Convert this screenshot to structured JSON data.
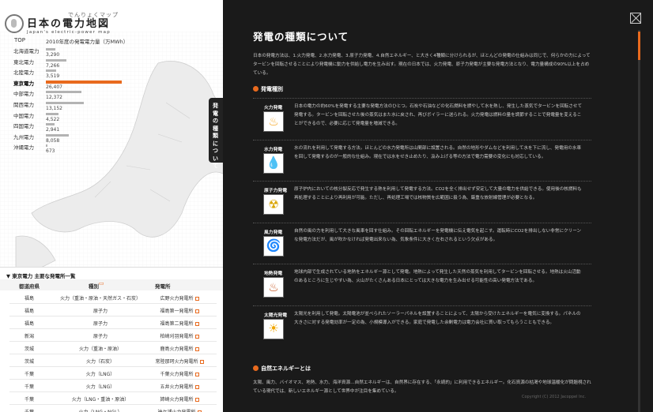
{
  "app": {
    "ruby": "でんりょくマップ",
    "title": "日本の電力地図",
    "subtitle": "Japan's electric-power map"
  },
  "map": {
    "top_label": "TOP",
    "year_label": "2010年度の発電電力量（万MWh）",
    "max_value": 26407,
    "regions": [
      {
        "name": "北海道電力",
        "value": 3290,
        "value_text": "3,290",
        "selected": false
      },
      {
        "name": "東北電力",
        "value": 7266,
        "value_text": "7,266",
        "selected": false
      },
      {
        "name": "北陸電力",
        "value": 3519,
        "value_text": "3,519",
        "selected": false
      },
      {
        "name": "東京電力",
        "value": 26407,
        "value_text": "26,407",
        "selected": true
      },
      {
        "name": "中部電力",
        "value": 12372,
        "value_text": "12,372",
        "selected": false
      },
      {
        "name": "関西電力",
        "value": 13152,
        "value_text": "13,152",
        "selected": false
      },
      {
        "name": "中国電力",
        "value": 4522,
        "value_text": "4,522",
        "selected": false
      },
      {
        "name": "四国電力",
        "value": 2941,
        "value_text": "2,941",
        "selected": false
      },
      {
        "name": "九州電力",
        "value": 8058,
        "value_text": "8,058",
        "selected": false
      },
      {
        "name": "沖縄電力",
        "value": 673,
        "value_text": "673",
        "selected": false
      }
    ]
  },
  "plant_list": {
    "title": "▼ 東京電力 主要な発電所一覧",
    "columns": [
      "都道府県",
      "種別",
      "発電所"
    ],
    "rows": [
      {
        "pref": "福島",
        "type": "火力（重油・原油・天然ガス・石炭）",
        "plant": "広野火力発電所"
      },
      {
        "pref": "福島",
        "type": "原子力",
        "plant": "福島第一発電所"
      },
      {
        "pref": "福島",
        "type": "原子力",
        "plant": "福島第二発電所"
      },
      {
        "pref": "新潟",
        "type": "原子力",
        "plant": "柏崎刈羽発電所"
      },
      {
        "pref": "茨城",
        "type": "火力（重油・原油）",
        "plant": "鹿島火力発電所"
      },
      {
        "pref": "茨城",
        "type": "火力（石炭）",
        "plant": "常陸那珂火力発電所"
      },
      {
        "pref": "千葉",
        "type": "火力（LNG）",
        "plant": "千葉火力発電所"
      },
      {
        "pref": "千葉",
        "type": "火力（LNG）",
        "plant": "五井火力発電所"
      },
      {
        "pref": "千葉",
        "type": "火力（LNG・重油・原油）",
        "plant": "姉崎火力発電所"
      },
      {
        "pref": "千葉",
        "type": "火力（LNG・NGL）",
        "plant": "袖ケ浦火力発電所"
      }
    ]
  },
  "side_tab": {
    "label": "発電の種類について"
  },
  "panel": {
    "title": "発電の種類について",
    "intro": "日本の発電方法は、1.火力発電、2.水力発電、3.原子力発電、4.自然エネルギー、と大きく4種類に分けられるが、ほとんどの発電の仕組みは同じで、何らかの力によってタービンを回転させることにより発電機に動力を供給し電力を生み出す。現在の日本では、火力発電、原子力発電が主要な発電方法となり、電力量構成の90%以上を占めている。",
    "section_title": "発電種別",
    "types": [
      {
        "name": "火力発電",
        "icon": "fire-icon",
        "glyph": "♨",
        "color": "#f5a623",
        "desc": "日本の電力の約60%を発電する主要な発電方法のひとつ。石炭や石油などの化石燃料を燃やして水を熱し、発生した蒸気でタービンを回転させて発電する。タービンを回転させた後の蒸気はまた水に戻され、再びボイラーに送られる。火力発電は燃料の量を調節することで発電量を変えることができるので、必要に応じて発電量を増減できる。"
      },
      {
        "name": "水力発電",
        "icon": "water-drop-icon",
        "glyph": "💧",
        "color": "#3a8fd6",
        "desc": "水の流れを利用して発電する方法。ほとんどの水力発電所は山間部に設置される。自然の地形やダムなどを利用して水を下に流し、発電用の水車を回して発電するのが一般的な仕組み。現在では水をせき止めたり、汲み上げる等の方法で電力需要の変化にも対応している。"
      },
      {
        "name": "原子力発電",
        "icon": "radiation-icon",
        "glyph": "☢",
        "color": "#d9a400",
        "desc": "原子炉内においての核分裂反応で発生する熱を利用して発電する方法。CO2を全く排出せず安定して大量の電力を供給できる。使用後の核燃料も再処理することにより再利用が可能。ただし、再処理工場では核物質を広範囲に扱う為、厳重な放射線管理が必要となる。"
      },
      {
        "name": "風力発電",
        "icon": "wind-icon",
        "glyph": "🌀",
        "color": "#2f8fd8",
        "desc": "自然の風の力を利用して大きな風車を回す仕組み。その回転エネルギーを発電機に伝え電気を起こす。運転時にCO2を排出しない非常にクリーンな発電方法だが、風が吹かなければ発電出来ない為、気象条件に大きく左右されるという欠点がある。"
      },
      {
        "name": "地熱発電",
        "icon": "geothermal-icon",
        "glyph": "♨",
        "color": "#c4501a",
        "desc": "地球内部で生成されている地熱をエネルギー源として発電。地熱によって発生した天然の蒸気を利用してタービンを回転させる。地熱は火山活動のあるところに生じやすい為、火山がたくさんある日本にとっては大きな電力を生み出せる可能性の高い発電方法である。"
      },
      {
        "name": "太陽光発電",
        "icon": "sun-icon",
        "glyph": "☀",
        "color": "#f0a500",
        "desc": "太陽光を利用して発電。太陽電池が並べられたソーラーパネルを設置することによって、太陽から受けたエネルギーを電気に変換する。パネルの大きさに対する発電効率が一定の為、小規模導入ができる。家庭で発電した余剰電力は電力会社に買い取ってもらうこともできる。"
      }
    ],
    "re_title": "自然エネルギーとは",
    "re_text": "太陽、風力、バイオマス、地熱、水力、海洋資源…自然エネルギーは、自然界に存在する、「永続的」に利用できるエネルギー。化石資源の枯渇や地球温暖化が問題視されている現代では、新しいエネルギー源として世界中が注目を集めている。",
    "footer": "Copyright (C) 2012 Jacoppel Inc."
  },
  "colors": {
    "accent": "#e86a1e",
    "panel_bg": "#1a1a1a",
    "bar": "#b3b3b3"
  }
}
